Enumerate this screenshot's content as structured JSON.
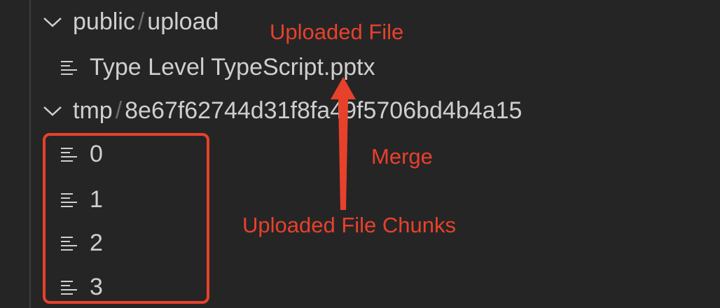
{
  "explorer": {
    "folders": [
      {
        "parent": "public",
        "child": "upload"
      },
      {
        "parent": "tmp",
        "child": "8e67f62744d31f8fa49f5706bd4b4a15"
      }
    ],
    "files": {
      "uploaded": "Type Level TypeScript.pptx",
      "chunks": [
        "0",
        "1",
        "2",
        "3"
      ]
    },
    "separator": "/"
  },
  "annotations": {
    "uploaded_file": "Uploaded File",
    "merge": "Merge",
    "chunks": "Uploaded File Chunks"
  },
  "icons": {
    "folder_toggle": "chevron-down-icon",
    "file": "file-lines-icon",
    "arrow": "arrow-up-icon"
  },
  "colors": {
    "background": "#252526",
    "text": "#cfcfcf",
    "annotation": "#e8412b"
  }
}
